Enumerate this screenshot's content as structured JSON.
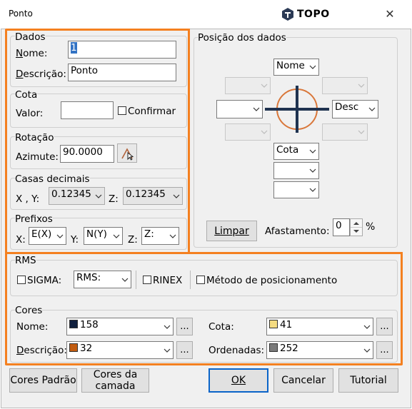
{
  "window": {
    "title": "Ponto",
    "brand": "TOPO",
    "close_glyph": "✕"
  },
  "dados": {
    "legend": "Dados",
    "nome_label": "Nome:",
    "nome_value": "1",
    "descricao_label": "Descrição:",
    "descricao_value": "Ponto"
  },
  "cota": {
    "legend": "Cota",
    "valor_label": "Valor:",
    "valor_value": "",
    "confirmar_label": "Confirmar"
  },
  "rotacao": {
    "legend": "Rotação",
    "azimute_label": "Azimute:",
    "azimute_value": "90.0000"
  },
  "casas": {
    "legend": "Casas decimais",
    "xy_label": "X , Y:",
    "xy_value": "0.12345",
    "z_label": "Z:",
    "z_value": "0.12345"
  },
  "prefixos": {
    "legend": "Prefixos",
    "x_label": "X:",
    "x_value": "E(X)",
    "y_label": "Y:",
    "y_value": "N(Y)",
    "z_label": "Z:",
    "z_value": "Z:"
  },
  "posicao": {
    "legend": "Posição dos dados",
    "top_value": "Nome",
    "right_value": "Desc",
    "bottom1_value": "Cota",
    "limpar_label": "Limpar",
    "afastamento_label": "Afastamento:",
    "afastamento_value": "0",
    "percent": "%"
  },
  "rms": {
    "legend": "RMS",
    "sigma_label": "SIGMA:",
    "rms_value": "RMS:",
    "rinex_label": "RINEX",
    "metodo_label": "Método de posicionamento"
  },
  "cores": {
    "legend": "Cores",
    "nome_label": "Nome:",
    "nome_value": "158",
    "nome_color": "#0f1f3d",
    "descricao_label": "Descrição:",
    "descricao_value": "32",
    "descricao_color": "#c25c10",
    "cota_label": "Cota:",
    "cota_value": "41",
    "cota_color": "#f5dc82",
    "ordenadas_label": "Ordenadas:",
    "ordenadas_value": "252",
    "ordenadas_color": "#7a7a7a",
    "ellipsis": "..."
  },
  "buttons": {
    "cores_padrao": "Cores Padrão",
    "cores_camada_1": "Cores da",
    "cores_camada_2": "camada",
    "ok": "OK",
    "cancelar": "Cancelar",
    "tutorial": "Tutorial"
  },
  "colors": {
    "highlight": "#f48020",
    "cross": "#1f3350",
    "circle": "#d9773a"
  }
}
